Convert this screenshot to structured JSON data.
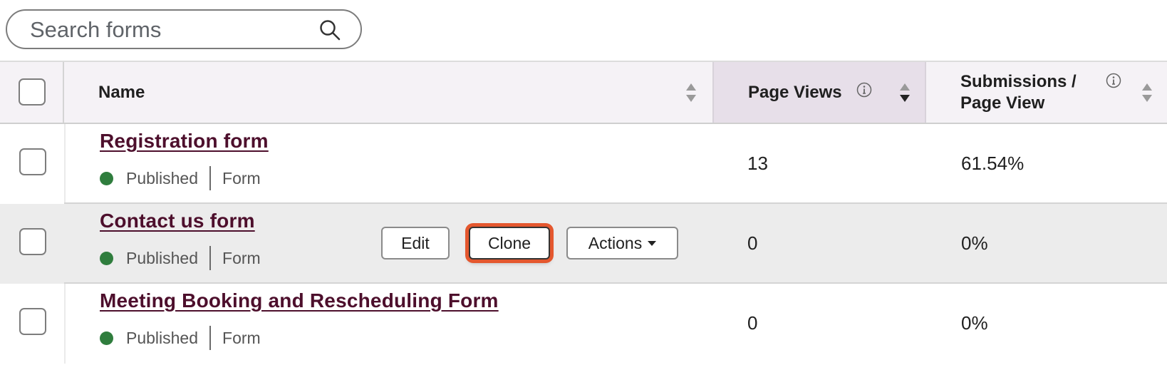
{
  "search": {
    "placeholder": "Search forms",
    "icon": "search-icon"
  },
  "header": {
    "name_label": "Name",
    "page_views_label": "Page Views",
    "submissions_label_line1": "Submissions /",
    "submissions_label_line2": "Page View"
  },
  "rows": [
    {
      "name": "Registration form",
      "status": "Published",
      "type": "Form",
      "page_views": "13",
      "submission_rate": "61.54%"
    },
    {
      "name": "Contact us form",
      "status": "Published",
      "type": "Form",
      "page_views": "0",
      "submission_rate": "0%"
    },
    {
      "name": "Meeting Booking and Rescheduling Form",
      "status": "Published",
      "type": "Form",
      "page_views": "0",
      "submission_rate": "0%"
    }
  ],
  "row_actions": {
    "edit": "Edit",
    "clone": "Clone",
    "actions": "Actions"
  },
  "colors": {
    "link": "#4d0f2c",
    "published_dot": "#2f7d3d",
    "highlight": "#e4572e",
    "sorted_column_bg": "#e7dfe9"
  }
}
